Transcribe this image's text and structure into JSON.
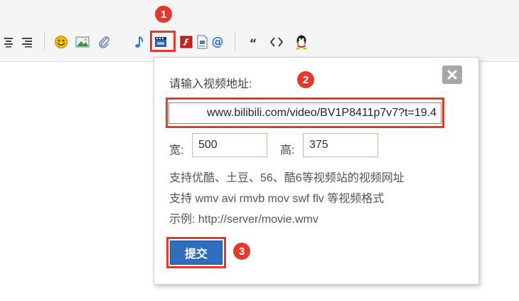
{
  "dialog": {
    "prompt": "请输入视频地址:",
    "url_value": "www.bilibili.com/video/BV1P8411p7v7?t=19.4",
    "width_label": "宽:",
    "width_value": "500",
    "height_label": "高:",
    "height_value": "375",
    "info_lines": [
      "支持优酷、土豆、56、酷6等视频站的视频网址",
      "支持 wmv avi rmvb mov swf flv 等视频格式",
      "示例: http://server/movie.wmv"
    ],
    "submit_label": "提交"
  },
  "markers": [
    "1",
    "2",
    "3"
  ],
  "colors": {
    "highlight": "#e23b2e",
    "submit": "#2f6dbf",
    "close": "#a7a7a7"
  },
  "icons": [
    "align-center-icon",
    "align-right-icon",
    "smiley-icon",
    "image-icon",
    "attachment-icon",
    "music-icon",
    "video-icon",
    "flash-icon",
    "document-icon",
    "at-icon",
    "quote-icon",
    "code-icon",
    "qq-icon",
    "close-icon"
  ]
}
